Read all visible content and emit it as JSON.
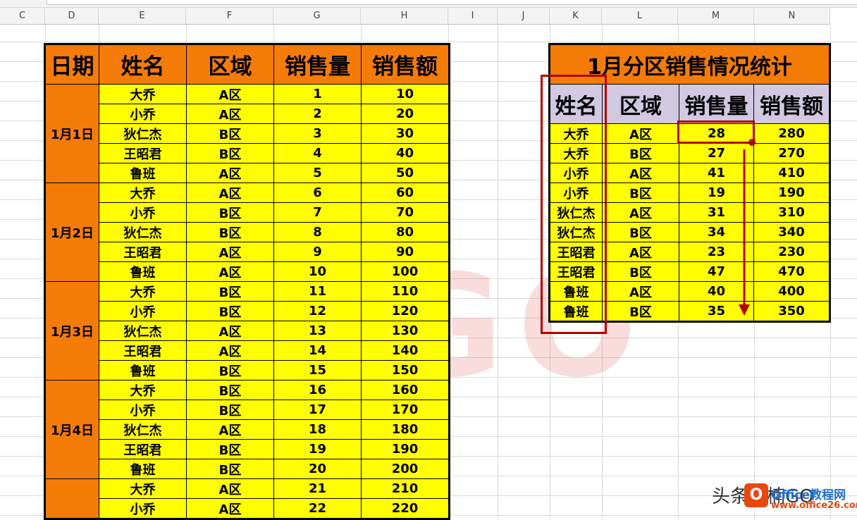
{
  "columns": [
    "C",
    "D",
    "E",
    "F",
    "G",
    "H",
    "I",
    "J",
    "K",
    "L",
    "M",
    "N"
  ],
  "left_table": {
    "headers": [
      "日期",
      "姓名",
      "区域",
      "销售量",
      "销售额"
    ],
    "groups": [
      {
        "date": "1月1日",
        "rows": [
          [
            "大乔",
            "A区",
            "1",
            "10"
          ],
          [
            "小乔",
            "A区",
            "2",
            "20"
          ],
          [
            "狄仁杰",
            "B区",
            "3",
            "30"
          ],
          [
            "王昭君",
            "B区",
            "4",
            "40"
          ],
          [
            "鲁班",
            "A区",
            "5",
            "50"
          ]
        ]
      },
      {
        "date": "1月2日",
        "rows": [
          [
            "大乔",
            "A区",
            "6",
            "60"
          ],
          [
            "小乔",
            "B区",
            "7",
            "70"
          ],
          [
            "狄仁杰",
            "B区",
            "8",
            "80"
          ],
          [
            "王昭君",
            "A区",
            "9",
            "90"
          ],
          [
            "鲁班",
            "A区",
            "10",
            "100"
          ]
        ]
      },
      {
        "date": "1月3日",
        "rows": [
          [
            "大乔",
            "B区",
            "11",
            "110"
          ],
          [
            "小乔",
            "B区",
            "12",
            "120"
          ],
          [
            "狄仁杰",
            "A区",
            "13",
            "130"
          ],
          [
            "王昭君",
            "A区",
            "14",
            "140"
          ],
          [
            "鲁班",
            "B区",
            "15",
            "150"
          ]
        ]
      },
      {
        "date": "1月4日",
        "rows": [
          [
            "大乔",
            "B区",
            "16",
            "160"
          ],
          [
            "小乔",
            "B区",
            "17",
            "170"
          ],
          [
            "狄仁杰",
            "A区",
            "18",
            "180"
          ],
          [
            "王昭君",
            "B区",
            "19",
            "190"
          ],
          [
            "鲁班",
            "B区",
            "20",
            "200"
          ]
        ]
      },
      {
        "date": "",
        "rows": [
          [
            "大乔",
            "A区",
            "21",
            "210"
          ],
          [
            "小乔",
            "A区",
            "22",
            "220"
          ]
        ]
      }
    ]
  },
  "summary_table": {
    "title": "1月分区销售情况统计",
    "headers": [
      "姓名",
      "区域",
      "销售量",
      "销售额"
    ],
    "rows": [
      [
        "大乔",
        "A区",
        "28",
        "280"
      ],
      [
        "大乔",
        "B区",
        "27",
        "270"
      ],
      [
        "小乔",
        "A区",
        "41",
        "410"
      ],
      [
        "小乔",
        "B区",
        "19",
        "190"
      ],
      [
        "狄仁杰",
        "A区",
        "31",
        "310"
      ],
      [
        "狄仁杰",
        "B区",
        "34",
        "340"
      ],
      [
        "王昭君",
        "A区",
        "23",
        "230"
      ],
      [
        "王昭君",
        "B区",
        "47",
        "470"
      ],
      [
        "鲁班",
        "A区",
        "40",
        "400"
      ],
      [
        "鲁班",
        "B区",
        "35",
        "350"
      ]
    ]
  },
  "watermark": "楠GO",
  "credit": "头条@楠GO",
  "logo": {
    "letter": "O",
    "name": "Office教程网",
    "url": "www.office26.com"
  },
  "colors": {
    "orange": "#f47c06",
    "yellow": "#ffff00",
    "lavender": "#d1c8e2",
    "red": "#b00000"
  }
}
